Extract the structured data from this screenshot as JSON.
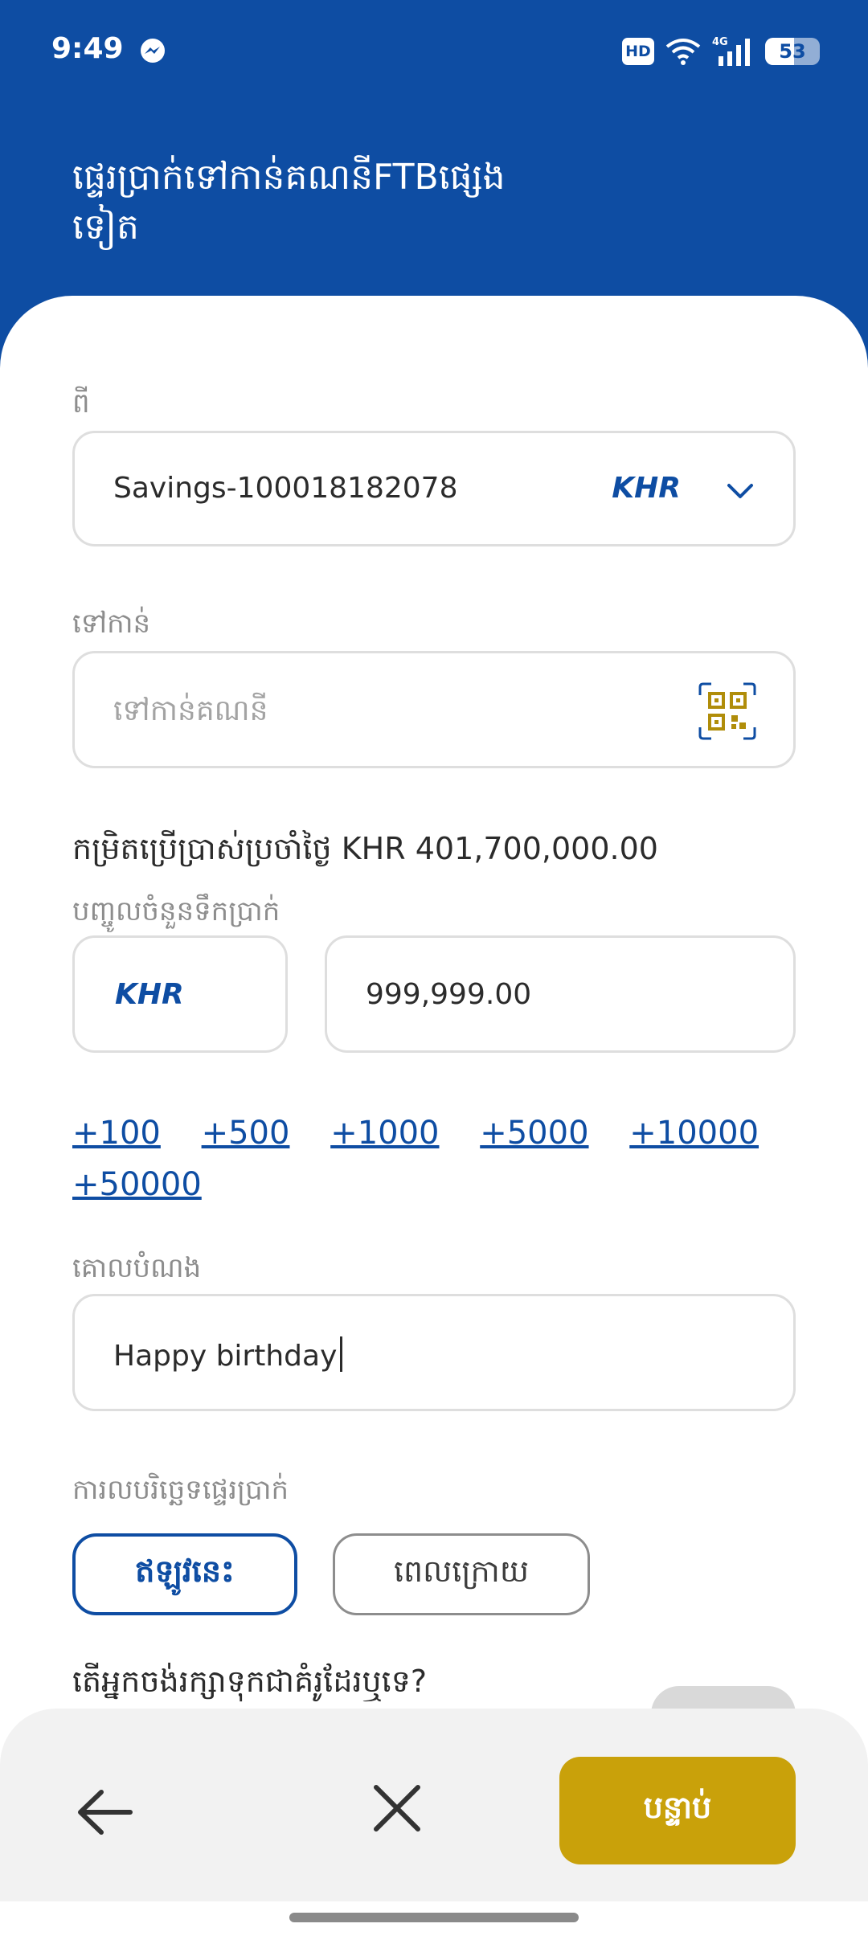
{
  "status_bar": {
    "time": "9:49",
    "messenger_icon": "messenger-icon",
    "hd_label": "HD",
    "network_label": "4G",
    "battery_level": "53",
    "battery_fraction": 0.53
  },
  "header": {
    "title": "ផ្ទេរប្រាក់ទៅកាន់គណនីFTBផ្សេងទៀត"
  },
  "from": {
    "label": "ពី",
    "account": "Savings-100018182078",
    "currency": "KHR",
    "dropdown_icon": "chevron-down-icon"
  },
  "to": {
    "label": "ទៅកាន់",
    "placeholder": "ទៅកាន់គណនី",
    "qr_icon": "qr-scan-icon"
  },
  "limit": {
    "label": "កម្រិតប្រើប្រាស់ប្រចាំថ្ងៃ",
    "value": "KHR 401,700,000.00"
  },
  "amount": {
    "label": "បញ្ចូលចំនួនទឹកប្រាក់",
    "currency": "KHR",
    "value": "999,999.00"
  },
  "quick_amounts": [
    "+100",
    "+500",
    "+1000",
    "+5000",
    "+10000",
    "+50000"
  ],
  "purpose": {
    "label": "គោលបំណង",
    "value": "Happy birthday"
  },
  "schedule": {
    "label": "ការលបរិច្ឆេទផ្ទេរប្រាក់",
    "now": "ឥឡូវនេះ",
    "later": "ពេលក្រោយ",
    "selected": "now"
  },
  "partial_row": {
    "text": "តើអ្នកចង់រក្សាទុកជាគំរូដែរឬទេ?"
  },
  "bottom": {
    "back_icon": "arrow-left-icon",
    "close_icon": "close-icon",
    "next_label": "បន្ទាប់"
  },
  "colors": {
    "primary": "#0e4da3",
    "accent": "#c9a10a"
  }
}
